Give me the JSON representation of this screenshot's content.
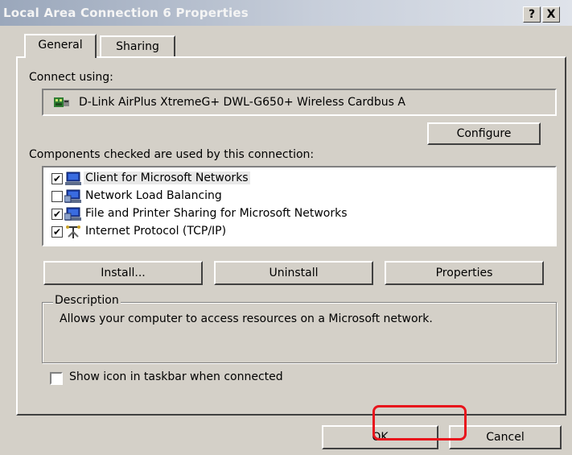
{
  "window": {
    "title": "Local Area Connection 6 Properties",
    "help_button": "?",
    "close_button": "X"
  },
  "tabs": [
    {
      "label": "General",
      "active": true
    },
    {
      "label": "Sharing",
      "active": false
    }
  ],
  "connect_using": {
    "label": "Connect using:",
    "adapter": "D-Link AirPlus XtremeG+ DWL-G650+ Wireless Cardbus A",
    "configure_button": "Configure"
  },
  "components": {
    "label": "Components checked are used by this connection:",
    "items": [
      {
        "label": "Client for Microsoft Networks",
        "checked": true,
        "selected": true,
        "icon": "network-client-icon"
      },
      {
        "label": "Network Load Balancing",
        "checked": false,
        "selected": false,
        "icon": "network-service-icon"
      },
      {
        "label": "File and Printer Sharing for Microsoft Networks",
        "checked": true,
        "selected": false,
        "icon": "network-service-icon"
      },
      {
        "label": "Internet Protocol (TCP/IP)",
        "checked": true,
        "selected": false,
        "icon": "protocol-icon"
      }
    ],
    "install_button": "Install...",
    "uninstall_button": "Uninstall",
    "properties_button": "Properties"
  },
  "description": {
    "label": "Description",
    "text": "Allows your computer to access resources on a Microsoft network."
  },
  "taskbar_option": {
    "label": "Show icon in taskbar when connected",
    "checked": false
  },
  "footer": {
    "ok_button": "OK",
    "cancel_button": "Cancel",
    "highlight_color": "#e8141c"
  }
}
